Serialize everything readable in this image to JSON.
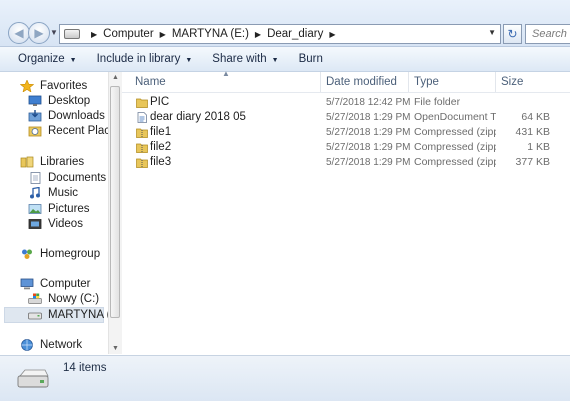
{
  "address": {
    "crumbs": [
      "Computer",
      "MARTYNA (E:)",
      "Dear_diary"
    ],
    "search_placeholder": "Search MA"
  },
  "toolbar": {
    "organize": "Organize",
    "include": "Include in library",
    "share": "Share with",
    "burn": "Burn"
  },
  "nav": {
    "favorites": "Favorites",
    "desktop": "Desktop",
    "downloads": "Downloads",
    "recent": "Recent Places",
    "libraries": "Libraries",
    "documents": "Documents",
    "music": "Music",
    "pictures": "Pictures",
    "videos": "Videos",
    "homegroup": "Homegroup",
    "computer": "Computer",
    "nowy": "Nowy (C:)",
    "martyna": "MARTYNA (E:)",
    "network": "Network"
  },
  "columns": {
    "name": "Name",
    "date": "Date modified",
    "type": "Type",
    "size": "Size"
  },
  "files": [
    {
      "name": "PIC",
      "date": "5/7/2018 12:42 PM",
      "type": "File folder",
      "size": "",
      "icon": "folder-icon"
    },
    {
      "name": "dear diary 2018 05",
      "date": "5/27/2018 1:29 PM",
      "type": "OpenDocument T...",
      "size": "64 KB",
      "icon": "document-icon"
    },
    {
      "name": "file1",
      "date": "5/27/2018 1:29 PM",
      "type": "Compressed (zipp...",
      "size": "431 KB",
      "icon": "zip-folder-icon"
    },
    {
      "name": "file2",
      "date": "5/27/2018 1:29 PM",
      "type": "Compressed (zipp...",
      "size": "1 KB",
      "icon": "zip-folder-icon"
    },
    {
      "name": "file3",
      "date": "5/27/2018 1:29 PM",
      "type": "Compressed (zipp...",
      "size": "377 KB",
      "icon": "zip-folder-icon"
    }
  ],
  "status": {
    "count": "14 items"
  },
  "colors": {
    "accent": "#3a6ab2",
    "selection": "#dfe7f0",
    "folder": "#e8c65a"
  }
}
